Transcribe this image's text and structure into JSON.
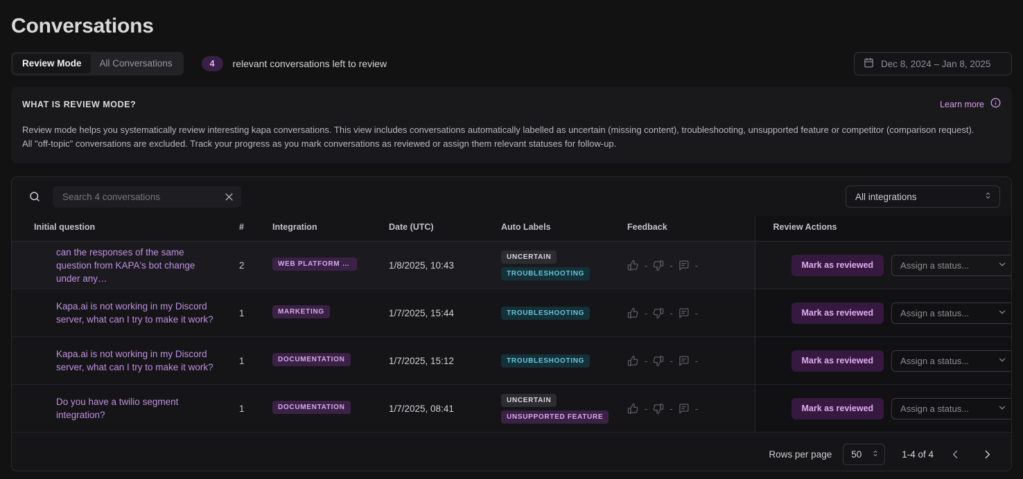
{
  "header": {
    "title": "Conversations",
    "tabs": [
      {
        "label": "Review Mode",
        "active": true
      },
      {
        "label": "All Conversations",
        "active": false
      }
    ],
    "count_badge": "4",
    "count_text": "relevant conversations left to review",
    "date_range": "Dec 8, 2024 – Jan 8, 2025",
    "calendar_icon": "calendar-icon"
  },
  "info_panel": {
    "title": "WHAT IS REVIEW MODE?",
    "learn_more": "Learn more",
    "info_icon": "info-circle-icon",
    "line1": "Review mode helps you systematically review interesting kapa conversations. This view includes conversations automatically labelled as uncertain (missing content), troubleshooting, unsupported feature or competitor (comparison request).",
    "line2": "All \"off-topic\" conversations are excluded. Track your progress as you mark conversations as reviewed or assign them relevant statuses for follow-up."
  },
  "toolbar": {
    "search_icon": "search-icon",
    "search_value": "",
    "search_placeholder": "Search 4 conversations",
    "clear_icon": "close-icon",
    "integrations_value": "All integrations",
    "integrations_icon": "chevron-updown-icon"
  },
  "table": {
    "columns": [
      "Initial question",
      "#",
      "Integration",
      "Date (UTC)",
      "Auto Labels",
      "Feedback",
      "Review Actions"
    ],
    "rows": [
      {
        "question": "can the responses of the same question from KAPA's bot change under any…",
        "count": "2",
        "integration": "WEB PLATFORM (A…",
        "date": "1/8/2025, 10:43",
        "labels": [
          {
            "text": "UNCERTAIN",
            "style": "uncertain"
          },
          {
            "text": "TROUBLESHOOTING",
            "style": "troubleshooting"
          }
        ],
        "thumbs_up": "-",
        "thumbs_down": "-",
        "comments": "-",
        "review_button": "Mark as reviewed",
        "status_value": "Assign a status..."
      },
      {
        "question": "Kapa.ai is not working in my Discord server, what can I try to make it work?",
        "count": "1",
        "integration": "MARKETING",
        "date": "1/7/2025, 15:44",
        "labels": [
          {
            "text": "TROUBLESHOOTING",
            "style": "troubleshooting"
          }
        ],
        "thumbs_up": "-",
        "thumbs_down": "-",
        "comments": "-",
        "review_button": "Mark as reviewed",
        "status_value": "Assign a status..."
      },
      {
        "question": "Kapa.ai is not working in my Discord server, what can I try to make it work?",
        "count": "1",
        "integration": "DOCUMENTATION",
        "date": "1/7/2025, 15:12",
        "labels": [
          {
            "text": "TROUBLESHOOTING",
            "style": "troubleshooting"
          }
        ],
        "thumbs_up": "-",
        "thumbs_down": "-",
        "comments": "-",
        "review_button": "Mark as reviewed",
        "status_value": "Assign a status..."
      },
      {
        "question": "Do you have a twilio segment integration?",
        "count": "1",
        "integration": "DOCUMENTATION",
        "date": "1/7/2025, 08:41",
        "labels": [
          {
            "text": "UNCERTAIN",
            "style": "uncertain"
          },
          {
            "text": "UNSUPPORTED FEATURE",
            "style": "unsupported"
          }
        ],
        "thumbs_up": "-",
        "thumbs_down": "-",
        "comments": "-",
        "review_button": "Mark as reviewed",
        "status_value": "Assign a status..."
      }
    ]
  },
  "footer": {
    "rows_per_page_label": "Rows per page",
    "rows_per_page_value": "50",
    "range": "1-4 of 4",
    "prev_icon": "chevron-left-icon",
    "next_icon": "chevron-right-icon"
  },
  "colors": {
    "background": "#121212",
    "accent_purple": "#c08fe0",
    "badge_purple_bg": "#3b2146",
    "badge_teal_bg": "#143139",
    "badge_teal_text": "#67c4da"
  }
}
